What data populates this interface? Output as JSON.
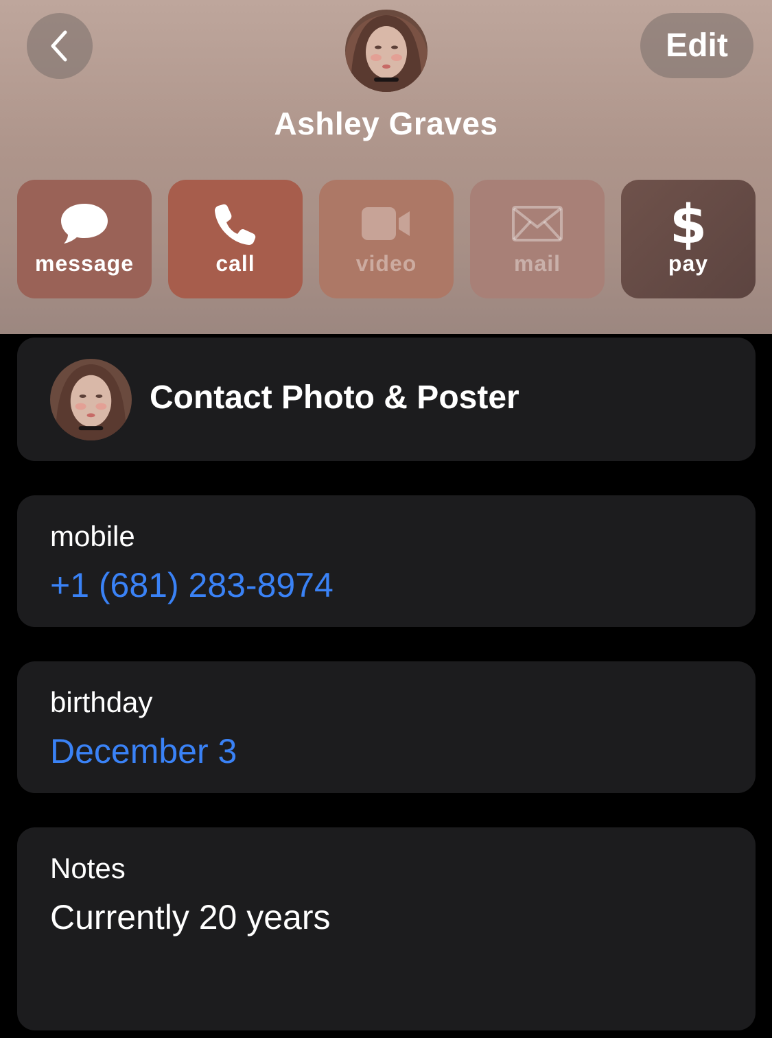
{
  "header": {
    "name": "Ashley Graves",
    "edit_label": "Edit",
    "back_icon": "chevron-left-icon"
  },
  "actions": [
    {
      "label": "message",
      "icon": "message-bubble-icon",
      "enabled": true
    },
    {
      "label": "call",
      "icon": "phone-icon",
      "enabled": true
    },
    {
      "label": "video",
      "icon": "video-camera-icon",
      "enabled": false
    },
    {
      "label": "mail",
      "icon": "envelope-icon",
      "enabled": false
    },
    {
      "label": "pay",
      "icon": "dollar-icon",
      "enabled": true
    }
  ],
  "contact_photo": {
    "label": "Contact Photo & Poster"
  },
  "mobile": {
    "label": "mobile",
    "value": "+1 (681) 283-8974"
  },
  "birthday": {
    "label": "birthday",
    "value": "December 3"
  },
  "notes": {
    "label": "Notes",
    "value": "Currently 20 years"
  },
  "colors": {
    "link_blue": "#3a82f6",
    "card_bg": "#1c1c1e",
    "page_bg": "#000000"
  }
}
